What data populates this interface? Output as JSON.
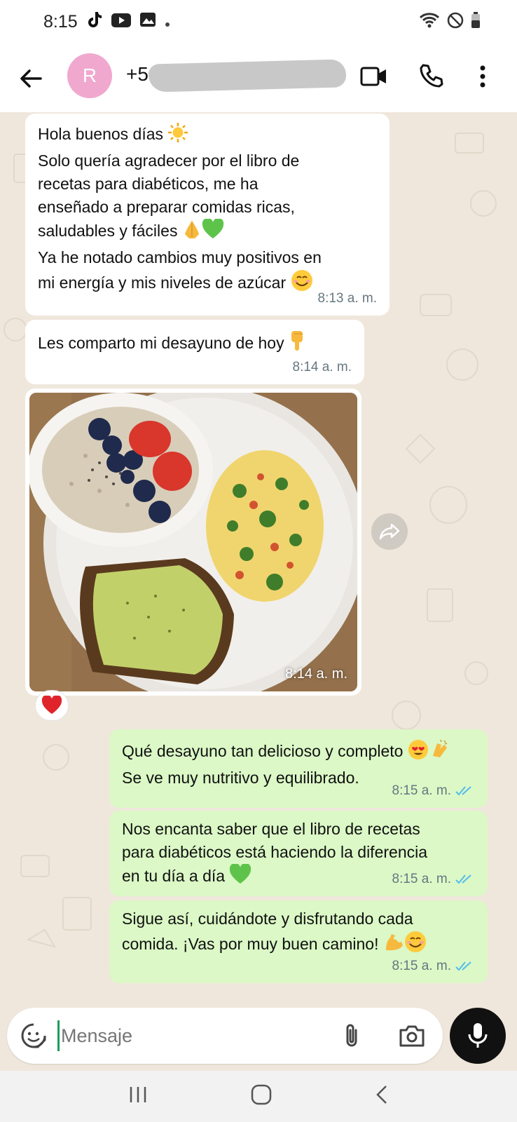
{
  "status_bar": {
    "time": "8:15"
  },
  "header": {
    "avatar_letter": "R",
    "contact_name": "+5"
  },
  "messages": [
    {
      "lines": [
        "Hola buenos días",
        "Solo quería agradecer por el libro de",
        "recetas para diabéticos, me ha",
        "enseñado a preparar comidas ricas,",
        "saludables y fáciles",
        "Ya he notado cambios muy positivos en",
        "mi energía y mis niveles de azúcar"
      ],
      "time": "8:13 a. m."
    },
    {
      "text": "Les comparto mi desayuno de hoy",
      "time": "8:14 a. m."
    },
    {
      "image_time": "8:14 a. m.",
      "reaction": "heart"
    },
    {
      "lines": [
        "Qué desayuno tan delicioso y completo",
        "Se ve muy nutritivo y equilibrado."
      ],
      "time": "8:15 a. m."
    },
    {
      "lines": [
        "Nos encanta saber que el libro de recetas",
        "para diabéticos está haciendo la diferencia",
        "en tu día a día"
      ],
      "time": "8:15 a. m."
    },
    {
      "lines": [
        "Sigue así, cuidándote y disfrutando cada",
        "comida. ¡Vas por muy buen camino!"
      ],
      "time": "8:15 a. m."
    }
  ],
  "composer": {
    "placeholder": "Mensaje"
  },
  "colors": {
    "outgoing": "#dbf8c6",
    "incoming": "#ffffff",
    "avatar": "#f0a8cf",
    "read_ticks": "#53bdeb",
    "background": "#efe7dc"
  }
}
